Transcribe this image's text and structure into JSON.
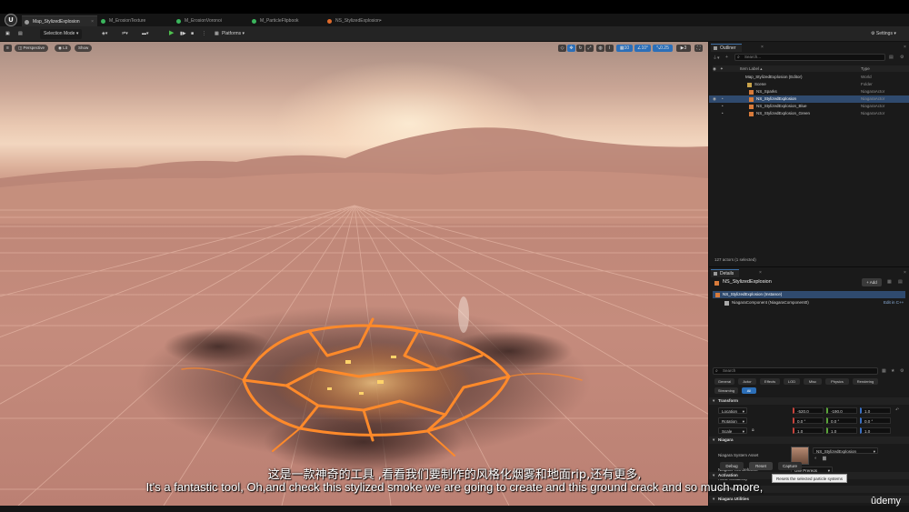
{
  "tabs": [
    {
      "label": "Map_StylizedExplosion",
      "color": "#9a9a9a",
      "active": true
    },
    {
      "label": "M_ErosionTexture",
      "color": "#3bb55d",
      "active": false
    },
    {
      "label": "M_ErosionVoronoi",
      "color": "#3bb55d",
      "active": false
    },
    {
      "label": "M_ParticleFlipbook",
      "color": "#3bb55d",
      "active": false
    },
    {
      "label": "NS_StylizedExplosion•",
      "color": "#e06b2b",
      "active": false
    }
  ],
  "toolbar": {
    "selection_mode": "Selection Mode",
    "platforms": "Platforms",
    "settings": "Settings"
  },
  "viewport": {
    "perspective": "Perspective",
    "lit": "Lit",
    "show": "Show",
    "snap_grid": "10",
    "snap_angle": "10°",
    "snap_scale": "0.25",
    "camera_speed": "3"
  },
  "outliner": {
    "title": "Outliner",
    "search_placeholder": "Search...",
    "col_label": "Item Label ▴",
    "col_type": "Type",
    "rows": [
      {
        "name": "Map_StylizedExplosion (Editor)",
        "type": "World",
        "indent": 0
      },
      {
        "name": "Scene",
        "type": "Folder",
        "indent": 1
      },
      {
        "name": "NS_Sparks",
        "type": "NiagaraActor",
        "indent": 2
      },
      {
        "name": "NS_StylizedExplosion",
        "type": "NiagaraActor",
        "indent": 2,
        "selected": true
      },
      {
        "name": "NS_StylizedExplosion_Blue",
        "type": "NiagaraActor",
        "indent": 2
      },
      {
        "name": "NS_StylizedExplosion_Green",
        "type": "NiagaraActor",
        "indent": 2
      }
    ],
    "footer": "127 actors (1 selected)"
  },
  "details": {
    "title": "Details",
    "actor_name": "NS_StylizedExplosion",
    "add_label": "+ Add",
    "instance_label": "NS_StylizedExplosion (Instance)",
    "component_label": "NiagaraComponent (NiagaraComponent0)",
    "edit_cpp": "Edit in C++",
    "search_placeholder": "Search",
    "cat_tabs": [
      "General",
      "Actor",
      "Effects",
      "LOD",
      "Misc",
      "Physics",
      "Rendering",
      "Streaming",
      "All"
    ],
    "sections": {
      "transform": "Transform",
      "niagara": "Niagara",
      "user_params": "User Parameters",
      "niagara_utilities": "Niagara Utilities",
      "activation": "Activation"
    },
    "location_label": "Location",
    "rotation_label": "Rotation",
    "scale_label": "Scale",
    "location": [
      "-520.0",
      "-190.0",
      "1.0"
    ],
    "rotation": [
      "0.0 °",
      "0.0 °",
      "0.0 °"
    ],
    "scale": [
      "1.0",
      "1.0",
      "1.0"
    ],
    "system_asset_label": "Niagara System Asset",
    "system_asset_value": "NS_StylizedExplosion",
    "tick_behavior_label": "Niagara Tick Behavior",
    "tick_behavior_value": "Use Prereqs",
    "allow_scalability_label": "Allow Scalability",
    "debug_label": "Debug",
    "reset_label": "Reset",
    "capture_label": "Capture",
    "tooltip": "Resets the selected particle systems"
  },
  "subtitles": {
    "cn": "这是一款神奇的工具 ,看看我们要制作的风格化烟雾和地面rip,还有更多,",
    "en": "It's a fantastic tool, Oh,and check this stylized smoke we are going to create and this ground crack and so much more,"
  },
  "watermark": "ûdemy",
  "colors": {
    "accent": "#2c6fb8",
    "selection": "#2f4a6e",
    "crack_glow": "#ff8a2a"
  }
}
